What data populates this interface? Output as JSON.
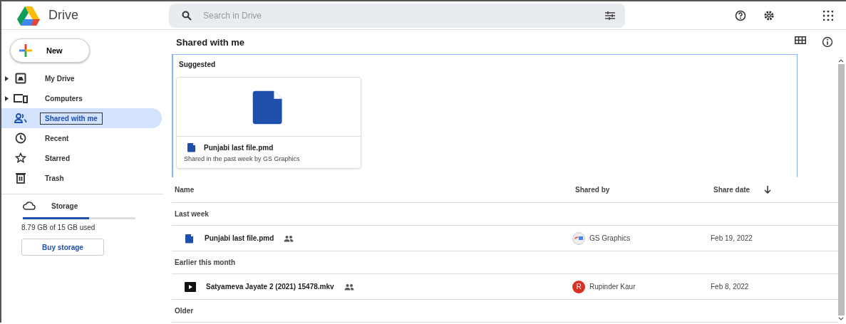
{
  "app": {
    "title": "Drive"
  },
  "search": {
    "placeholder": "Search in Drive"
  },
  "new_button": "New",
  "sidebar": {
    "items": [
      {
        "label": "My Drive",
        "kind": "drive",
        "expandable": true,
        "selected": false
      },
      {
        "label": "Computers",
        "kind": "computer",
        "expandable": true,
        "selected": false
      },
      {
        "label": "Shared with me",
        "kind": "people",
        "expandable": false,
        "selected": true
      },
      {
        "label": "Recent",
        "kind": "clock",
        "expandable": false,
        "selected": false
      },
      {
        "label": "Starred",
        "kind": "star",
        "expandable": false,
        "selected": false
      },
      {
        "label": "Trash",
        "kind": "trash",
        "expandable": false,
        "selected": false
      }
    ],
    "storage": {
      "label": "Storage",
      "level": 0.586,
      "usage": "8.79 GB of 15 GB used",
      "button": "Buy storage"
    }
  },
  "page_title": "Shared with me",
  "suggested": {
    "title": "Suggested",
    "cards": [
      {
        "name": "Punjabi last file.pmd",
        "detail": "Shared in the past week by GS Graphics"
      }
    ]
  },
  "table": {
    "columns": [
      "Name",
      "Shared by",
      "Share date"
    ],
    "groups": [
      {
        "title": "Last week",
        "rows": [
          {
            "kind": "doc",
            "name": "Punjabi last file.pmd",
            "shared": true,
            "owner": {
              "name": "GS Graphics",
              "kind": "logo"
            },
            "date": "Feb 19, 2022"
          }
        ]
      },
      {
        "title": "Earlier this month",
        "rows": [
          {
            "kind": "video",
            "name": "Satyameva Jayate 2 (2021) 15478.mkv",
            "shared": true,
            "owner": {
              "name": "Rupinder Kaur",
              "kind": "letter",
              "initial": "R",
              "color": "#d93025"
            },
            "date": "Feb 8, 2022"
          }
        ]
      },
      {
        "title": "Older"
      }
    ]
  }
}
